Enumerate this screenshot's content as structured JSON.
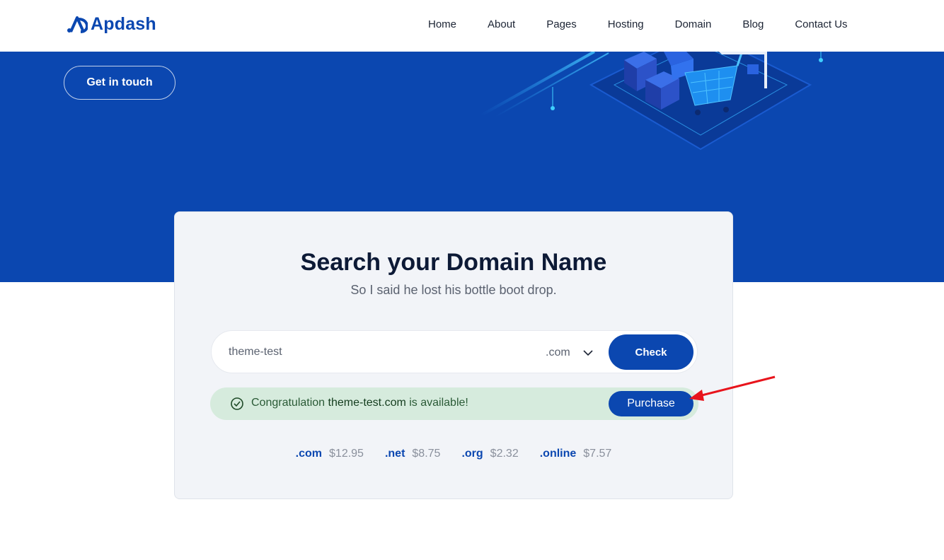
{
  "brand": {
    "name": "Apdash",
    "color": "#0b47b0"
  },
  "nav": {
    "items": [
      {
        "label": "Home"
      },
      {
        "label": "About"
      },
      {
        "label": "Pages"
      },
      {
        "label": "Hosting"
      },
      {
        "label": "Domain"
      },
      {
        "label": "Blog"
      },
      {
        "label": "Contact Us"
      }
    ]
  },
  "hero": {
    "cta_label": "Get in touch",
    "background": "#0b47b0"
  },
  "search": {
    "title": "Search your Domain Name",
    "subtitle": "So I said he lost his bottle boot drop.",
    "input_value": "theme-test",
    "tld_selected": ".com",
    "check_label": "Check"
  },
  "result": {
    "prefix": "Congratulation",
    "domain": "theme-test.com",
    "suffix": "is available!",
    "purchase_label": "Purchase",
    "background": "#d6ebdd"
  },
  "prices": [
    {
      "tld": ".com",
      "price": "$12.95"
    },
    {
      "tld": ".net",
      "price": "$8.75"
    },
    {
      "tld": ".org",
      "price": "$2.32"
    },
    {
      "tld": ".online",
      "price": "$7.57"
    }
  ],
  "annotation": {
    "arrow_color": "#e8141c"
  },
  "icons": {
    "logo": "apdash-logo-icon",
    "dropdown": "chevron-down-icon",
    "success": "check-circle-icon"
  }
}
